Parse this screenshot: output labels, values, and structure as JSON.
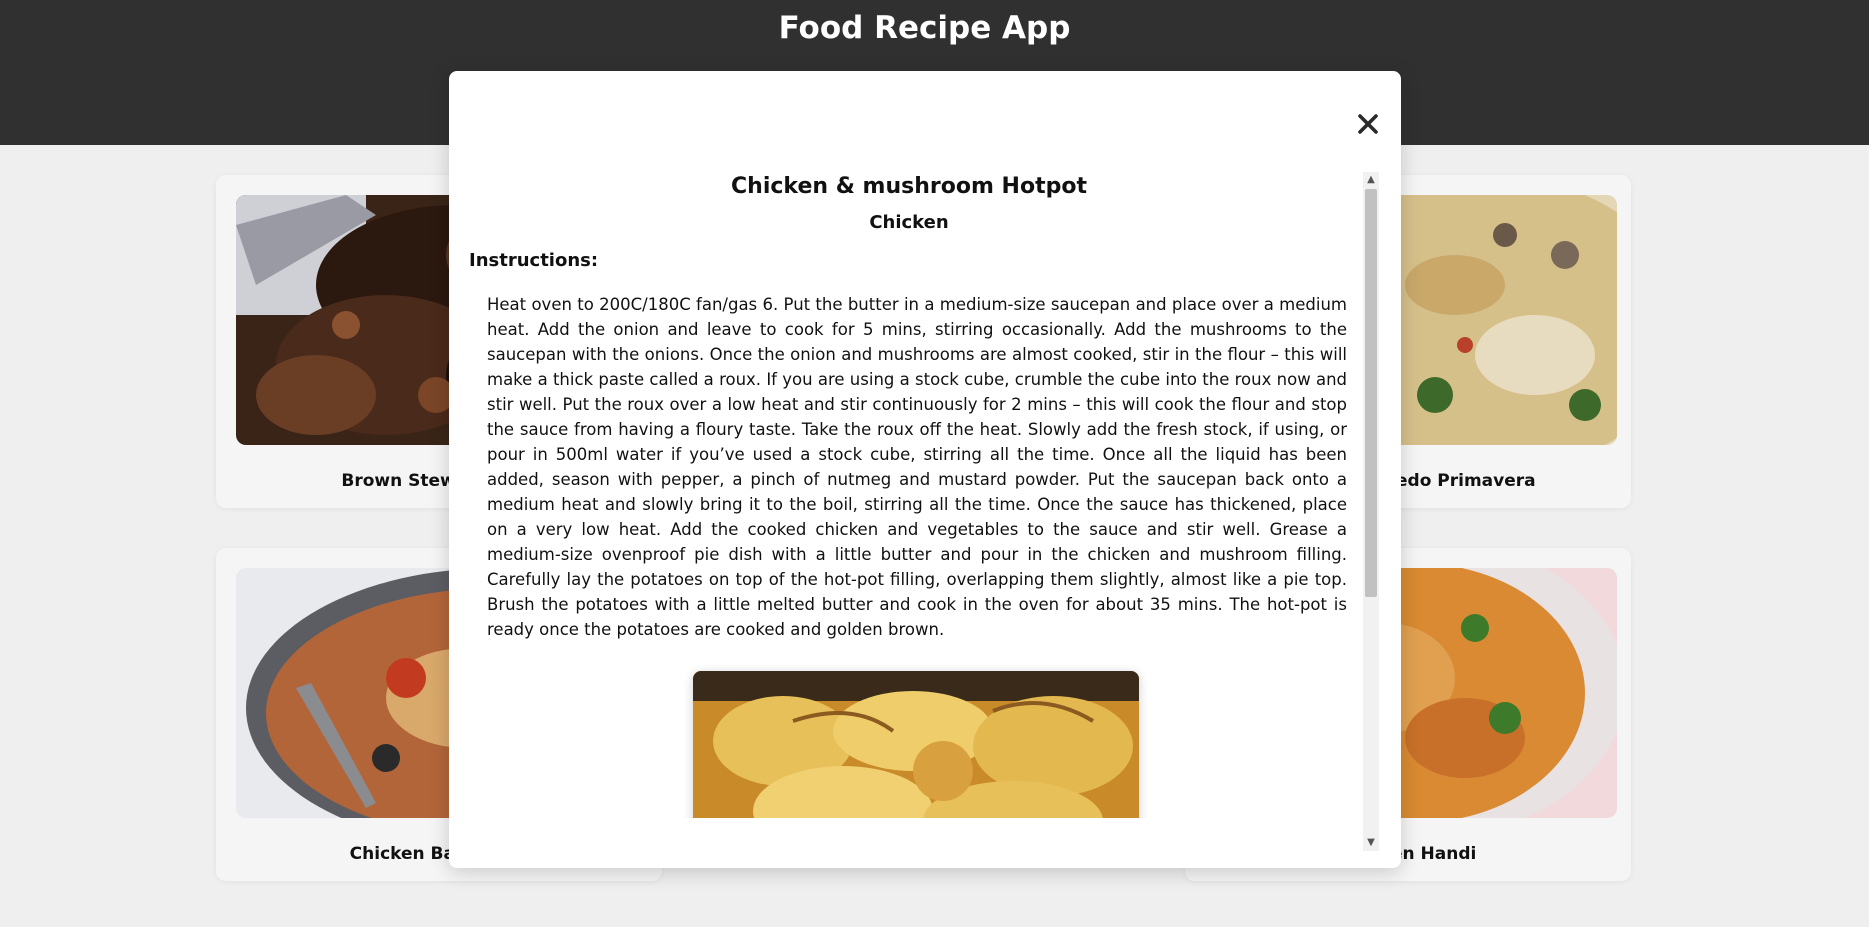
{
  "app": {
    "title": "Food Recipe App"
  },
  "cards": [
    {
      "name": "Brown Stew Chicken"
    },
    {
      "name": "Chicken Alfredo Primavera"
    },
    {
      "name": "Chicken Basquaise"
    },
    {
      "name": "Chicken Handi"
    }
  ],
  "modal": {
    "close_icon": "close-icon",
    "recipe_title": "Chicken & mushroom Hotpot",
    "category": "Chicken",
    "instructions_label": "Instructions:",
    "instructions": "Heat oven to 200C/180C fan/gas 6. Put the butter in a medium-size saucepan and place over a medium heat. Add the onion and leave to cook for 5 mins, stirring occasionally. Add the mushrooms to the saucepan with the onions. Once the onion and mushrooms are almost cooked, stir in the flour – this will make a thick paste called a roux. If you are using a stock cube, crumble the cube into the roux now and stir well. Put the roux over a low heat and stir continuously for 2 mins – this will cook the flour and stop the sauce from having a floury taste. Take the roux off the heat. Slowly add the fresh stock, if using, or pour in 500ml water if you’ve used a stock cube, stirring all the time. Once all the liquid has been added, season with pepper, a pinch of nutmeg and mustard powder. Put the saucepan back onto a medium heat and slowly bring it to the boil, stirring all the time. Once the sauce has thickened, place on a very low heat. Add the cooked chicken and vegetables to the sauce and stir well. Grease a medium-size ovenproof pie dish with a little butter and pour in the chicken and mushroom filling. Carefully lay the potatoes on top of the hot-pot filling, overlapping them slightly, almost like a pie top. Brush the potatoes with a little melted butter and cook in the oven for about 35 mins. The hot-pot is ready once the potatoes are cooked and golden brown."
  },
  "colors": {
    "header": "#303030",
    "background": "#efefef",
    "card": "#f5f5f5"
  }
}
